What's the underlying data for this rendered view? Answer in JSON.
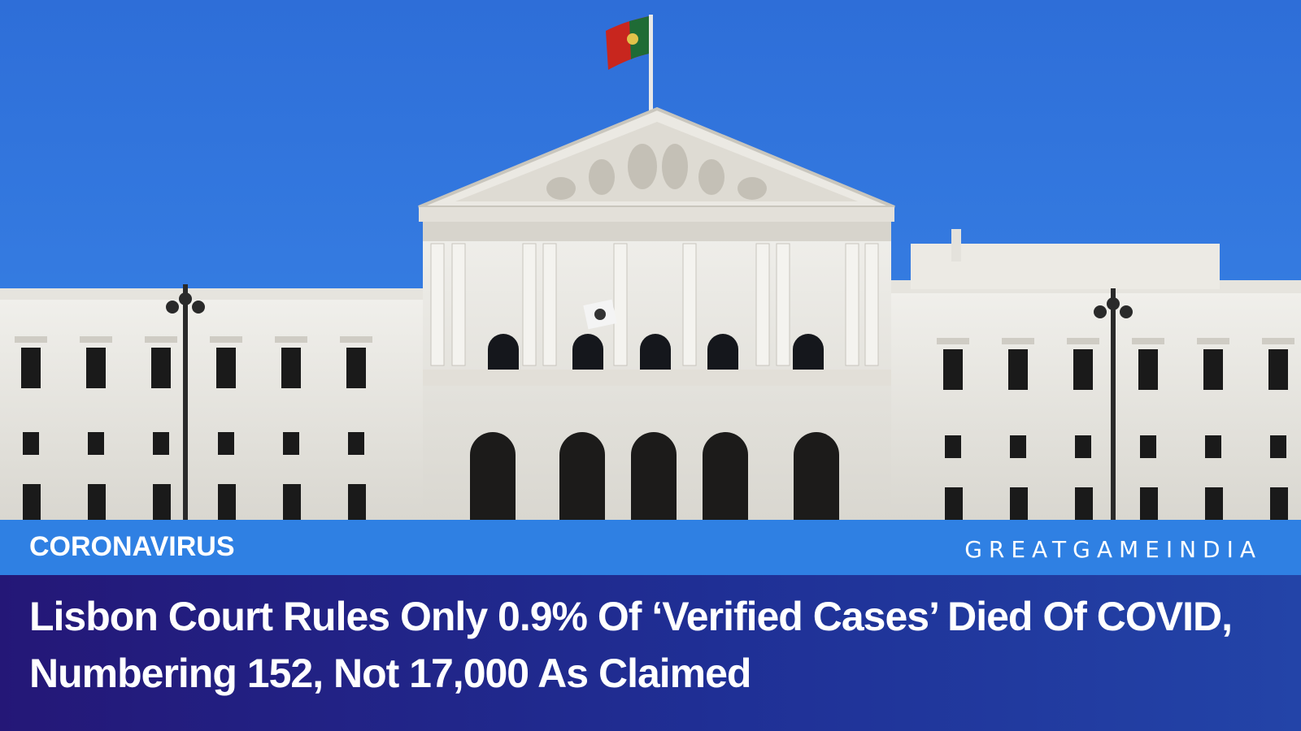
{
  "photo": {
    "subject": "Portuguese Parliament building (São Bento Palace) with flag",
    "sky_color": "#2f6fd6"
  },
  "category_bar": {
    "label": "CORONAVIRUS",
    "brand": "GREATGAMEINDIA",
    "color": "#2f80e3"
  },
  "headline": {
    "line1": "Lisbon Court Rules Only 0.9% Of ‘Verified Cases’ Died Of COVID,",
    "line2": "Numbering 152, Not 17,000 As Claimed",
    "background": "#1f2f95"
  }
}
